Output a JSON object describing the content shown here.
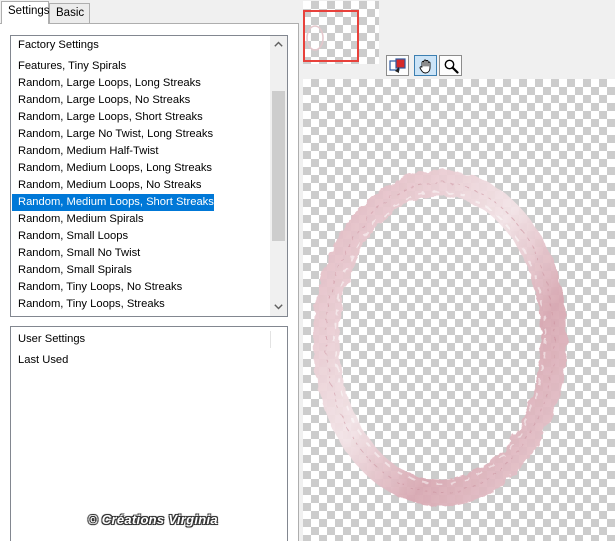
{
  "tabs": [
    {
      "label": "Settings",
      "active": true
    },
    {
      "label": "Basic",
      "active": false
    }
  ],
  "presets": {
    "items": [
      "Factory Settings",
      "Features, Tiny Spirals",
      "Random, Large Loops, Long Streaks",
      "Random, Large Loops, No Streaks",
      "Random, Large Loops, Short Streaks",
      "Random, Large No Twist, Long Streaks",
      "Random, Medium Half-Twist",
      "Random, Medium Loops, Long Streaks",
      "Random, Medium Loops, No Streaks",
      "Random, Medium Loops, Short Streaks",
      "Random, Medium Spirals",
      "Random, Small Loops",
      "Random, Small No Twist",
      "Random, Small Spirals",
      "Random, Tiny Loops, No Streaks",
      "Random, Tiny Loops, Streaks"
    ],
    "selected_index": 9
  },
  "user_settings": {
    "items": [
      "User Settings",
      "Last Used"
    ]
  },
  "toolbar": {
    "tools": [
      {
        "name": "preview-toggle-icon",
        "pressed": false
      },
      {
        "name": "hand-pan-icon",
        "pressed": true
      },
      {
        "name": "magnifier-zoom-icon",
        "pressed": false
      }
    ]
  },
  "watermark": "© Créations Virginia",
  "colors": {
    "selection": "#0078d7",
    "viewport_frame": "#e8413b",
    "frame_pink": "#dba9b2"
  }
}
